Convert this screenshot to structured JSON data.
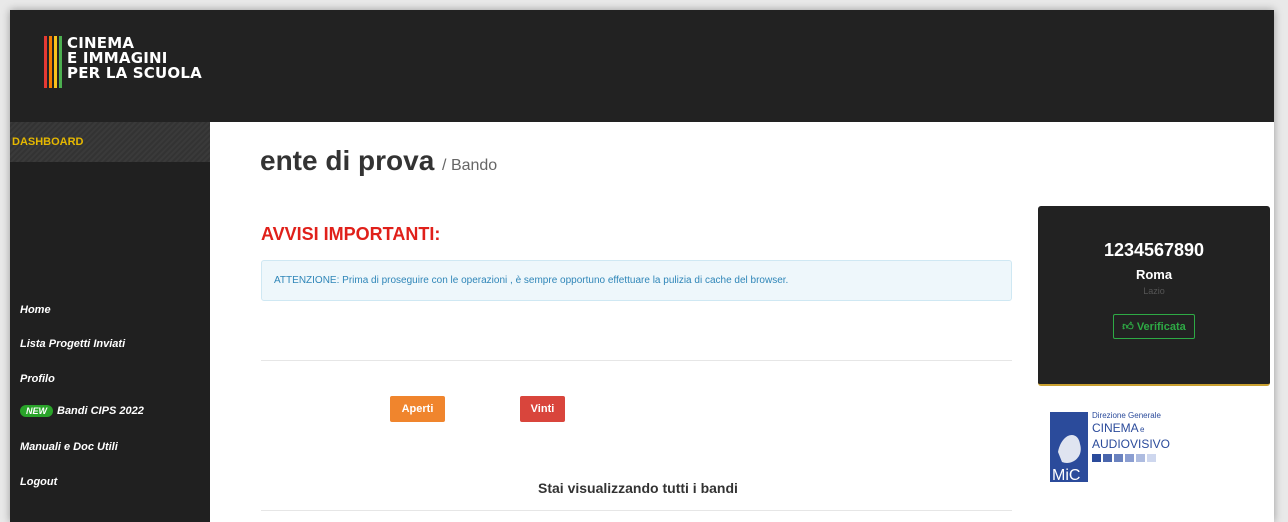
{
  "brand": {
    "logo_lines": [
      "CINEMA",
      "E IMMAGINI",
      "PER LA SCUOLA"
    ],
    "stripe_colors": [
      "#e53935",
      "#f57c00",
      "#f9c21b",
      "#4caf50"
    ]
  },
  "sidebar": {
    "header": "DASHBOARD",
    "items": [
      {
        "label": "Home"
      },
      {
        "label": "Lista Progetti Inviati"
      },
      {
        "label": "Profilo"
      },
      {
        "badge": "NEW",
        "label": "Bandi CIPS 2022"
      },
      {
        "label": "Manuali e Doc Utili"
      },
      {
        "label": "Logout"
      }
    ]
  },
  "main": {
    "title": "ente di prova",
    "subtitle": "/ Bando",
    "notice_heading": "AVVISI IMPORTANTI:",
    "notice_text": "ATTENZIONE: Prima di proseguire con le operazioni , è sempre opportuno effettuare la pulizia di cache del browser.",
    "buttons": {
      "aperti": "Aperti",
      "vinti": "Vinti"
    },
    "status_text": "Stai visualizzando tutti i bandi"
  },
  "profile_card": {
    "code": "1234567890",
    "city": "Roma",
    "region": "Lazio",
    "verify_label": "Verificata",
    "verify_icon": "thumbs-up-icon"
  },
  "mic_logo": {
    "lines": [
      "Direzione Generale",
      "CINEMA",
      "e",
      "AUDIOVISIVO"
    ],
    "mark": "MiC"
  },
  "colors": {
    "accent_orange": "#f0852d",
    "accent_red": "#d9453c",
    "alert_red": "#e0201a",
    "verify_green": "#2eaa45",
    "sidebar_gold": "#e6b800",
    "mic_blue": "#2b4b9b"
  }
}
